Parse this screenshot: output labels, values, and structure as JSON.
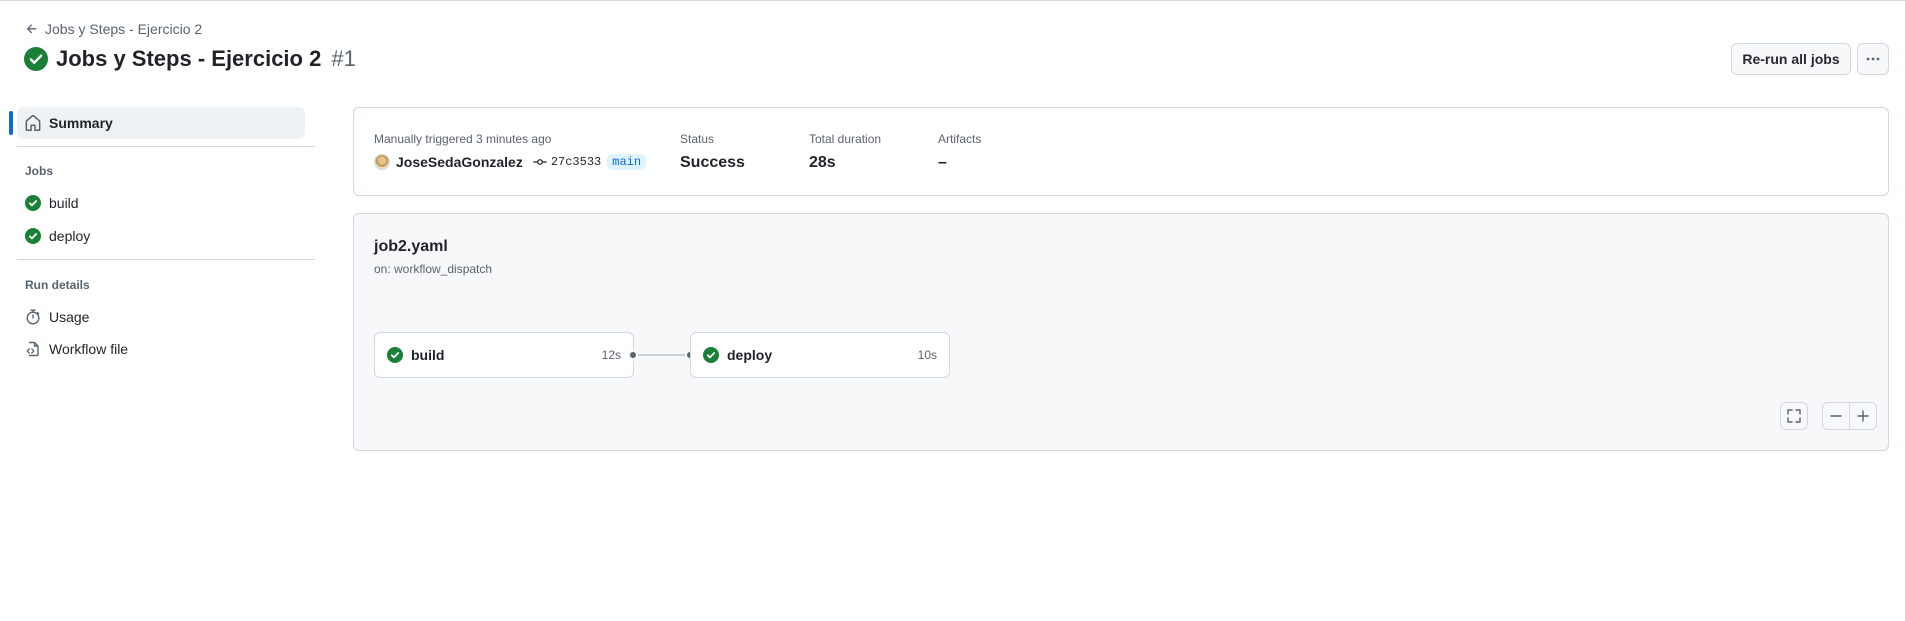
{
  "header": {
    "back_label": "Jobs y Steps - Ejercicio 2",
    "title": "Jobs y Steps - Ejercicio 2",
    "run_number": "#1",
    "rerun_label": "Re-run all jobs",
    "more_label": "···"
  },
  "sidebar": {
    "summary_label": "Summary",
    "jobs_heading": "Jobs",
    "jobs": [
      {
        "label": "build"
      },
      {
        "label": "deploy"
      }
    ],
    "run_details_heading": "Run details",
    "usage_label": "Usage",
    "workflow_file_label": "Workflow file"
  },
  "summary": {
    "trigger_label": "Manually triggered 3 minutes ago",
    "actor": "JoseSedaGonzalez",
    "commit": "27c3533",
    "branch": "main",
    "status_label": "Status",
    "status_value": "Success",
    "duration_label": "Total duration",
    "duration_value": "28s",
    "artifacts_label": "Artifacts",
    "artifacts_value": "–"
  },
  "graph": {
    "workflow_name": "job2.yaml",
    "trigger": "on: workflow_dispatch",
    "jobs": [
      {
        "name": "build",
        "duration": "12s"
      },
      {
        "name": "deploy",
        "duration": "10s"
      }
    ]
  },
  "colors": {
    "success": "#1a7f37",
    "accent": "#0969da"
  }
}
